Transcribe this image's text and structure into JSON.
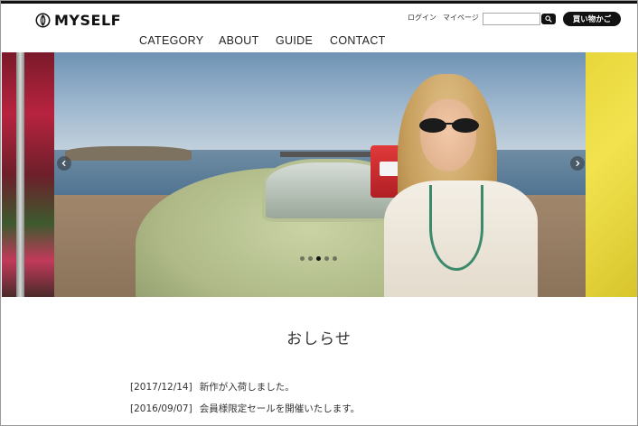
{
  "header": {
    "logo_text": "MYSELF",
    "login_label": "ログイン",
    "mypage_label": "マイページ",
    "search_placeholder": "",
    "search_icon": "search-icon",
    "cart_label": "買い物かご"
  },
  "nav": {
    "items": [
      {
        "label": "CATEGORY"
      },
      {
        "label": "ABOUT"
      },
      {
        "label": "GUIDE"
      },
      {
        "label": "CONTACT"
      }
    ]
  },
  "slider": {
    "slide_count": 5,
    "active_index": 2,
    "prev_icon": "chevron-left-icon",
    "next_icon": "chevron-right-icon"
  },
  "news": {
    "title": "おしらせ",
    "items": [
      {
        "date": "[2017/12/14]",
        "text": "新作が入荷しました。"
      },
      {
        "date": "[2016/09/07]",
        "text": "会員様限定セールを開催いたします。"
      }
    ]
  },
  "colors": {
    "accent": "#111111",
    "background": "#ffffff",
    "text": "#222222"
  }
}
